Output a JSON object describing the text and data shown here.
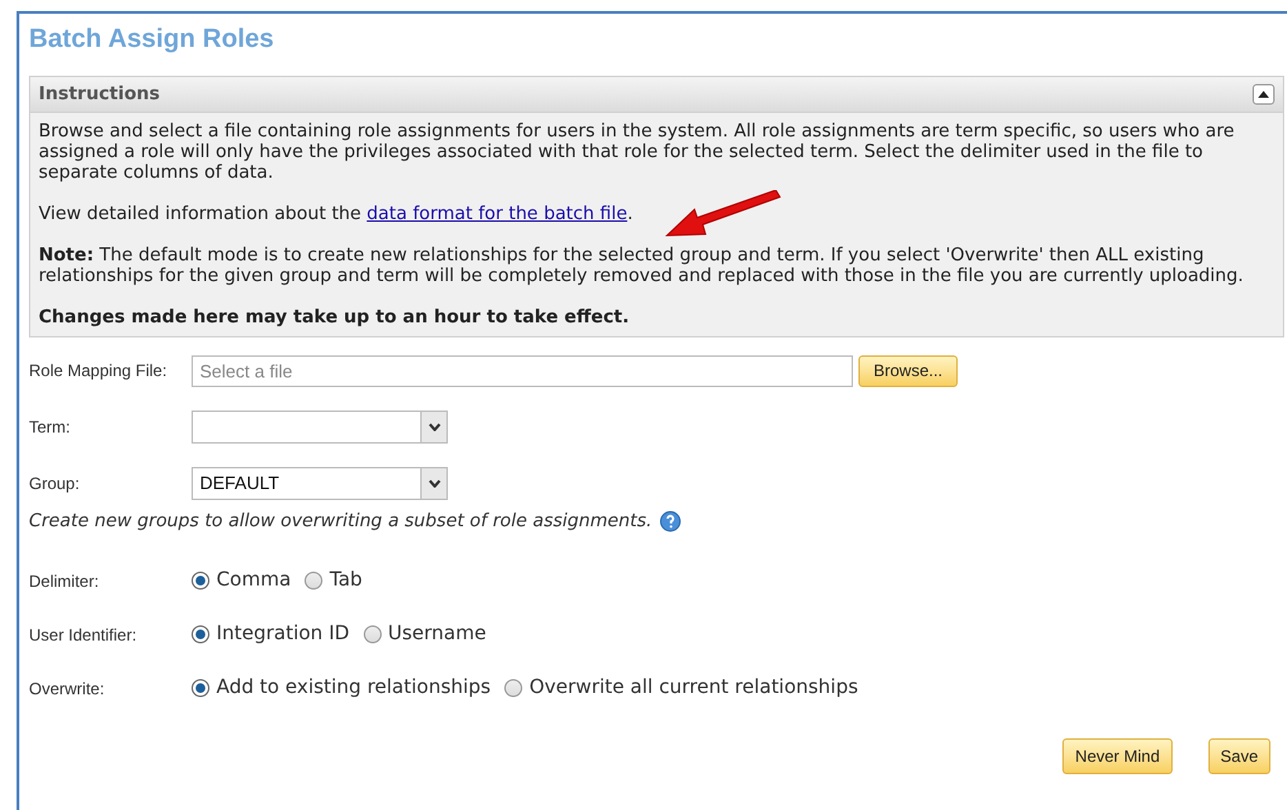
{
  "title": "Batch Assign Roles",
  "instructions": {
    "title": "Instructions",
    "expanded": true,
    "paragraph": "Browse and select a file containing role assignments for users in the system. All role assignments are term specific, so users who are assigned a role will only have the privileges associated with that role for the selected term. Select the delimiter used in the file to separate columns of data.",
    "link_prefix": "View detailed information about the ",
    "link": "data format for the batch file",
    "link_suffix": ".",
    "note": "**Note:** The default mode is to create new relationships for the selected group and term. If you select 'Overwrite' then ALL existing relationships for the given group and term will be completely removed and replaced with those in the file you are currently uploading.",
    "warning": "Changes made here may take up to an hour to take effect."
  },
  "file": {
    "label": "Role Mapping File:",
    "placeholder": "Select a file",
    "button": "Browse..."
  },
  "term": {
    "label": "Term:"
  },
  "group": {
    "label": "Group:",
    "value": "DEFAULT"
  },
  "group_hint": "Create new groups to allow overwriting a subset of role assignments.",
  "radio_groups": [
    {
      "label": "Delimiter:",
      "options": [
        {
          "label": "Comma",
          "selected": true
        },
        {
          "label": "Tab",
          "selected": false
        }
      ]
    },
    {
      "label": "User Identifier:",
      "options": [
        {
          "label": "Integration ID",
          "selected": true
        },
        {
          "label": "Username",
          "selected": false
        }
      ]
    },
    {
      "label": "Overwrite:",
      "options": [
        {
          "label": "Add to existing relationships",
          "selected": true
        },
        {
          "label": "Overwrite all current relationships",
          "selected": false
        }
      ]
    }
  ],
  "buttons": [
    "Never Mind",
    "Save"
  ]
}
